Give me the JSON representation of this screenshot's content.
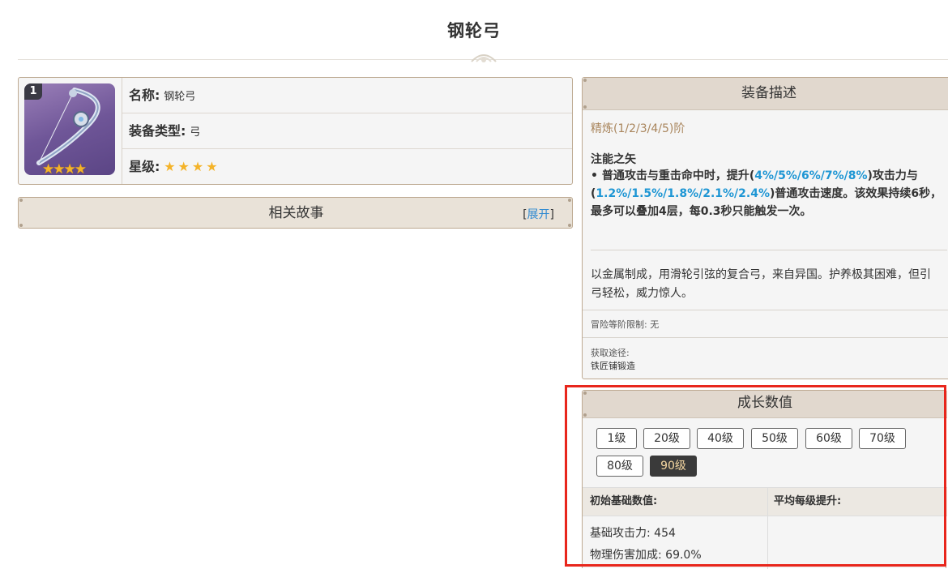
{
  "page": {
    "title": "钢轮弓"
  },
  "info": {
    "refine_badge": "1",
    "icon_stars": "★★★★",
    "name_label": "名称:",
    "name_value": "钢轮弓",
    "type_label": "装备类型:",
    "type_value": "弓",
    "rarity_label": "星级:",
    "rarity_stars": "★★★★",
    "rarity": 4
  },
  "story": {
    "title": "相关故事",
    "expand_open": "[",
    "expand_link": "展开",
    "expand_close": "]"
  },
  "description": {
    "header": "装备描述",
    "refine_levels": "精炼(1/2/3/4/5)阶",
    "passive_name": "注能之矢",
    "passive": {
      "p1": " • 普通攻击与重击命中时，提升(",
      "atk_values": "4%/5%/6%/7%/8%",
      "p2": ")攻击力与(",
      "spd_values": "1.2%/1.5%/1.8%/2.1%/2.4%",
      "p3": ")普通攻击速度。该效果持续6秒，最多可以叠加4层，每0.3秒只能触发一次。"
    },
    "lore": "以金属制成，用滑轮引弦的复合弓，来自异国。护养极其困难，但引弓轻松，威力惊人。",
    "ascension_limit": "冒险等阶限制: 无",
    "obtain_label": "获取途径:",
    "obtain_value": "铁匠铺锻造"
  },
  "growth": {
    "header": "成长数值",
    "levels": [
      "1级",
      "20级",
      "40级",
      "50级",
      "60级",
      "70级",
      "80级",
      "90级"
    ],
    "active_level": "90级",
    "col_base": "初始基础数值:",
    "col_avg": "平均每级提升:",
    "base_atk": "基础攻击力: 454",
    "phys_bonus": "物理伤害加成: 69.0%"
  },
  "colors": {
    "accent_blue": "#1e96d4",
    "refine_gold": "#a9855c",
    "star": "#f4b329",
    "highlight_red": "#e8261c"
  }
}
